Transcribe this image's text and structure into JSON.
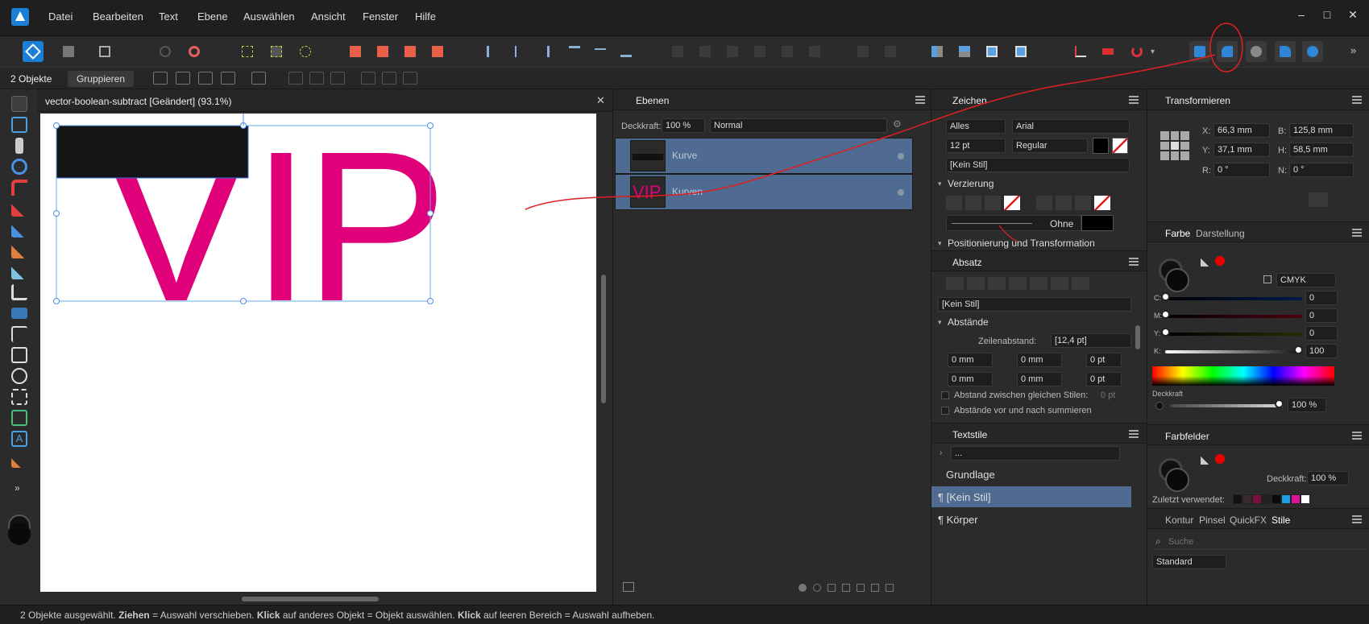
{
  "menu": {
    "items": [
      "Datei",
      "Bearbeiten",
      "Text",
      "Ebene",
      "Auswählen",
      "Ansicht",
      "Fenster",
      "Hilfe"
    ],
    "win_min": "–",
    "win_max": "□",
    "win_close": "✕"
  },
  "context": {
    "selection_count": "2 Objekte",
    "group_button": "Gruppieren"
  },
  "document": {
    "tab_title": "vector-boolean-subtract [Geändert] (93.1%)",
    "close": "✕",
    "letters": [
      "V",
      "I",
      "P"
    ]
  },
  "layers_panel": {
    "title": "Ebenen",
    "opacity_label": "Deckkraft:",
    "opacity_value": "100 %",
    "blend_mode": "Normal",
    "layers": [
      {
        "name": "Kurve"
      },
      {
        "name": "Kurven",
        "thumb_text": "VIP"
      }
    ]
  },
  "character_panel": {
    "title": "Zeichen",
    "scope": "Alles",
    "font": "Arial",
    "size": "12 pt",
    "weight": "Regular",
    "style": "[Kein Stil]",
    "decoration_section": "Verzierung",
    "decoration_none": "Ohne",
    "position_section": "Positionierung und Transformation"
  },
  "paragraph_panel": {
    "title": "Absatz",
    "style": "[Kein Stil]",
    "spacing_section": "Abstände",
    "line_spacing_label": "Zeilenabstand:",
    "line_spacing_value": "[12,4 pt]",
    "indent_left": "0 mm",
    "indent_right": "0 mm",
    "space_before": "0 pt",
    "first_line": "0 mm",
    "indent_last": "0 mm",
    "space_after": "0 pt",
    "check_same_styles": "Abstand zwischen gleichen Stilen:",
    "check_same_styles_value": "0 pt",
    "check_sum": "Abstände vor und nach summieren"
  },
  "text_styles_panel": {
    "title": "Textstile",
    "search": "...",
    "items": [
      "Grundlage",
      "¶ [Kein Stil]",
      "¶ Körper"
    ]
  },
  "transform_panel": {
    "title": "Transformieren",
    "x_label": "X:",
    "x": "66,3 mm",
    "y_label": "Y:",
    "y": "37,1 mm",
    "b_label": "B:",
    "b": "125,8 mm",
    "h_label": "H:",
    "h": "58,5 mm",
    "r_label": "R:",
    "r": "0 °",
    "n_label": "N:",
    "n": "0 °"
  },
  "color_panel": {
    "tabs": [
      "Farbe",
      "Darstellung"
    ],
    "model": "CMYK",
    "channels": [
      {
        "label": "C:",
        "value": "0"
      },
      {
        "label": "M:",
        "value": "0"
      },
      {
        "label": "Y:",
        "value": "0"
      },
      {
        "label": "K:",
        "value": "100"
      }
    ],
    "opacity_label": "Deckkraft",
    "opacity_value": "100 %"
  },
  "swatches_panel": {
    "title": "Farbfelder",
    "opacity_label": "Deckkraft:",
    "opacity_value": "100 %",
    "recent_label": "Zuletzt verwendet:",
    "recent_colors": [
      "#111111",
      "#3a2a30",
      "#7a1040",
      "#222222",
      "#0a0a0a",
      "#1aa0e0",
      "#e0109a",
      "#ffffff"
    ]
  },
  "styles_panel": {
    "tabs": [
      "Kontur",
      "Pinsel",
      "QuickFX",
      "Stile"
    ],
    "search_placeholder": "Suche",
    "category": "Standard"
  },
  "status": {
    "p1": "2 Objekte ausgewählt. ",
    "b1": "Ziehen",
    "p2": " = Auswahl verschieben. ",
    "b2": "Klick",
    "p3": " auf anderes Objekt = Objekt auswählen. ",
    "b3": "Klick",
    "p4": " auf leeren Bereich = Auswahl aufheben."
  },
  "colors": {
    "accent": "#1c7fd6",
    "magenta": "#e0007a",
    "layer_select": "#4f6b91",
    "annotation_red": "#e02020"
  }
}
